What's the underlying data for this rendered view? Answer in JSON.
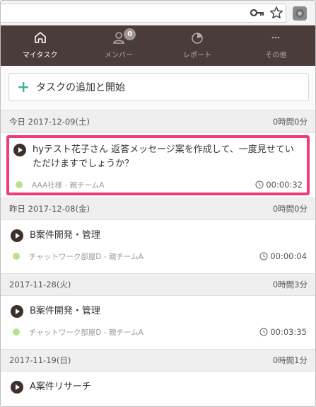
{
  "browser": {
    "icons": [
      "key-icon",
      "star-icon",
      "extension-icon"
    ]
  },
  "nav": {
    "items": [
      {
        "label": "マイタスク",
        "icon": "home-icon",
        "active": true
      },
      {
        "label": "メンバー",
        "icon": "person-icon",
        "badge": "0"
      },
      {
        "label": "レポート",
        "icon": "pie-chart-icon"
      },
      {
        "label": "その他",
        "icon": "more-icon"
      }
    ]
  },
  "add_task": {
    "label": "タスクの追加と開始",
    "icon": "plus-icon",
    "accent": "#3bb59a"
  },
  "days": [
    {
      "date": "今日 2017-12-09(土)",
      "total": "0時間0分",
      "tasks": [
        {
          "title": "hyテスト花子さん 返答メッセージ案を作成して、一度見せていただけますでしょうか？",
          "project": "AAA社様 - 親チームA",
          "time": "00:00:32",
          "highlighted": true
        }
      ]
    },
    {
      "date": "昨日 2017-12-08(金)",
      "total": "0時間0分",
      "tasks": [
        {
          "title": "B案件開発・管理",
          "project": "チャットワーク部屋D - 親チームA",
          "time": "00:00:04"
        }
      ]
    },
    {
      "date": "2017-11-28(火)",
      "total": "0時間3分",
      "tasks": [
        {
          "title": "B案件開発・管理",
          "project": "チャットワーク部屋D - 親チームA",
          "time": "00:03:35"
        }
      ]
    },
    {
      "date": "2017-11-19(日)",
      "total": "0時間1分",
      "tasks": [
        {
          "title": "A案件リサーチ"
        }
      ]
    }
  ],
  "colors": {
    "nav_bg": "#4a3c38",
    "highlight": "#f03a7a",
    "project_dot": "#b9e28c"
  }
}
